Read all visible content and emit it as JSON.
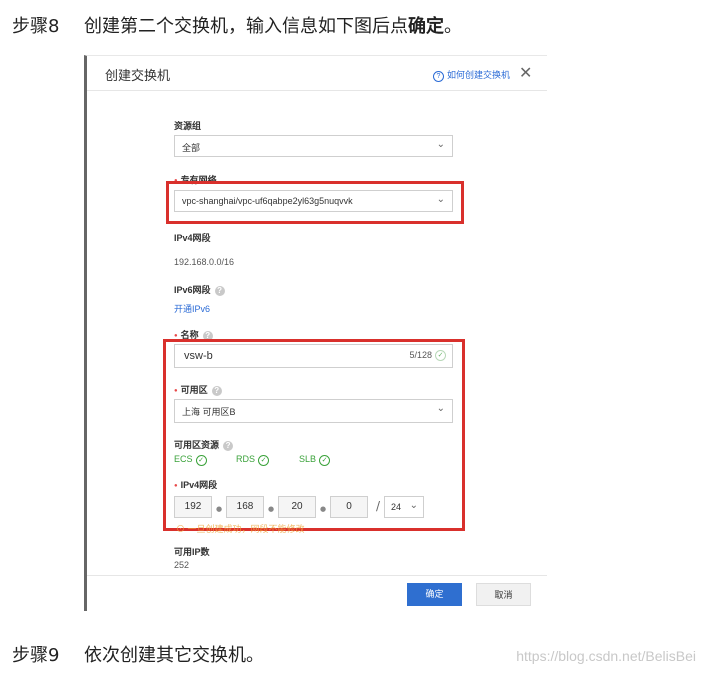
{
  "step8": {
    "num": "步骤8",
    "text": "创建第二个交换机，输入信息如下图后点",
    "bold": "确定",
    "end": "。"
  },
  "step9": {
    "num": "步骤9",
    "text": "依次创建其它交换机。"
  },
  "watermark": "https://blog.csdn.net/BelisBei",
  "dialog": {
    "title": "创建交换机",
    "help_link": "如何创建交换机",
    "close": "✕",
    "resource_group": {
      "label": "资源组",
      "value": "全部"
    },
    "vpc": {
      "label": "专有网络",
      "value": "vpc-shanghai/vpc-uf6qabpe2yl63g5nuqvvk"
    },
    "ipv4_cidr": {
      "label": "IPv4网段",
      "value": "192.168.0.0/16"
    },
    "ipv6_cidr": {
      "label": "IPv6网段",
      "link": "开通IPv6"
    },
    "name": {
      "label": "名称",
      "value": "vsw-b",
      "counter": "5/128"
    },
    "zone": {
      "label": "可用区",
      "value": "上海 可用区B"
    },
    "zone_resources": {
      "label": "可用区资源",
      "items": [
        "ECS",
        "RDS",
        "SLB"
      ]
    },
    "vsw_cidr": {
      "label": "IPv4网段",
      "octets": [
        "192",
        "168",
        "20",
        "0"
      ],
      "mask": "24"
    },
    "warning": "一旦创建成功，网段不能修改",
    "available_ip": {
      "label": "可用IP数",
      "value": "252"
    },
    "buttons": {
      "ok": "确定",
      "cancel": "取消"
    }
  },
  "colors": {
    "highlight": "#d9302c",
    "primary": "#2f6fd0",
    "success": "#3aa23a"
  }
}
